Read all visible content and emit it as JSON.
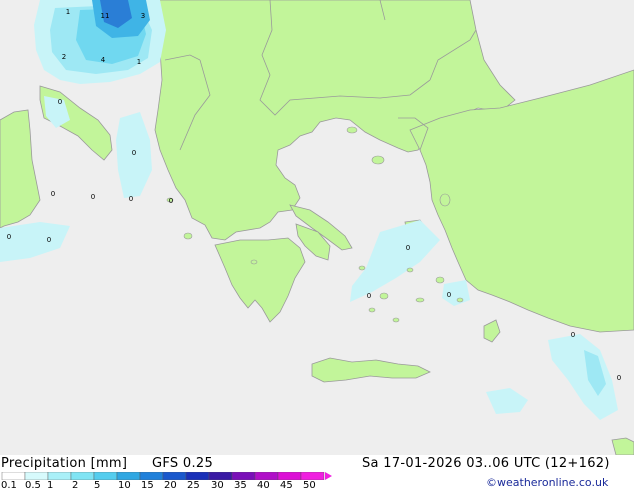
{
  "map": {
    "region": "Greece / Aegean Sea",
    "colors": {
      "sea": "#eeeeee",
      "land": "#c2f59a",
      "border": "#9a9a9a",
      "coast": "#9a9a9a"
    },
    "value_labels": [
      "11",
      "3",
      "1",
      "2",
      "4",
      "1",
      "0",
      "0",
      "0",
      "0",
      "0",
      "0",
      "0",
      "0",
      "0",
      "0",
      "0",
      "0",
      "0",
      "1",
      "0"
    ]
  },
  "footer": {
    "title": "Precipitation [mm]",
    "model": "GFS 0.25",
    "datetime": "Sa 17-01-2026 03..06 UTC (12+162)",
    "credit": "©weatheronline.co.uk",
    "scale_ticks": [
      "0.1",
      "0.5",
      "1",
      "2",
      "5",
      "10",
      "15",
      "20",
      "25",
      "30",
      "35",
      "40",
      "45",
      "50"
    ],
    "scale_colors": [
      "#ffffff",
      "#d7fafc",
      "#aaf0f8",
      "#80e4f4",
      "#55cdee",
      "#30a7e2",
      "#2080da",
      "#1a58cc",
      "#1a30b8",
      "#3a1aa4",
      "#7a10b8",
      "#b010c8",
      "#dc10d6",
      "#f020e0"
    ]
  }
}
